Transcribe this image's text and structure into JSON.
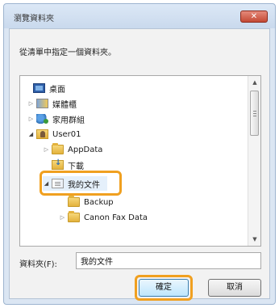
{
  "dialog": {
    "title": "瀏覽資料夾",
    "close_glyph": "✕",
    "instruction": "從清單中指定一個資料夾。"
  },
  "tree": {
    "items": [
      {
        "label": "桌面",
        "icon": "desktop-icon",
        "expander": "none"
      },
      {
        "label": "媒體櫃",
        "icon": "library-icon",
        "expander": "collapsed"
      },
      {
        "label": "家用群組",
        "icon": "network-icon",
        "expander": "collapsed"
      },
      {
        "label": "User01",
        "icon": "user-icon",
        "expander": "expanded"
      },
      {
        "label": "AppData",
        "icon": "folder-icon",
        "expander": "collapsed"
      },
      {
        "label": "下載",
        "icon": "download-icon",
        "expander": "none"
      },
      {
        "label": "我的文件",
        "icon": "doc-icon",
        "expander": "expanded",
        "selected": true
      },
      {
        "label": "Backup",
        "icon": "folder-icon",
        "expander": "none"
      },
      {
        "label": "Canon Fax Data",
        "icon": "folder-icon",
        "expander": "collapsed"
      }
    ]
  },
  "folder_field": {
    "label": "資料夾(F):",
    "value": "我的文件"
  },
  "buttons": {
    "ok": "確定",
    "cancel": "取消"
  },
  "colors": {
    "highlight": "#f0a020",
    "close_button": "#c44a35"
  }
}
